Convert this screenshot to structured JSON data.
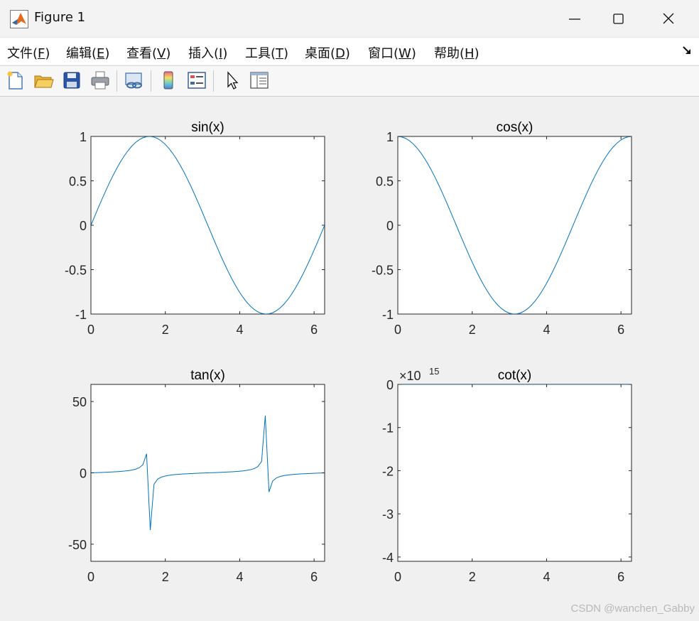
{
  "window": {
    "title": "Figure 1",
    "icon": "matlab-icon",
    "controls": [
      "minimize-icon",
      "maximize-icon",
      "close-icon"
    ]
  },
  "menu": [
    {
      "label": "文件(",
      "key": "F",
      "end": ")"
    },
    {
      "label": "编辑(",
      "key": "E",
      "end": ")"
    },
    {
      "label": "查看(",
      "key": "V",
      "end": ")"
    },
    {
      "label": "插入(",
      "key": "I",
      "end": ")"
    },
    {
      "label": "工具(",
      "key": "T",
      "end": ")"
    },
    {
      "label": "桌面(",
      "key": "D",
      "end": ")"
    },
    {
      "label": "窗口(",
      "key": "W",
      "end": ")"
    },
    {
      "label": "帮助(",
      "key": "H",
      "end": ")"
    }
  ],
  "toolbar": [
    "new-figure-icon",
    "open-file-icon",
    "save-icon",
    "print-icon",
    "link-plot-icon",
    "colorbar-icon",
    "legend-icon",
    "edit-plot-arrow-icon",
    "property-inspector-icon"
  ],
  "colors": {
    "line": "#0072bd",
    "axes": "#262626",
    "plot_bg": "#ffffff",
    "figure_bg": "#f0f0f0"
  },
  "watermark": "CSDN @wanchen_Gabby",
  "chart_data": [
    {
      "type": "line",
      "title": "sin(x)",
      "function": "sin",
      "xlim": [
        0,
        6.2832
      ],
      "ylim": [
        -1,
        1
      ],
      "xticks": [
        "0",
        "2",
        "4",
        "6"
      ],
      "yticks": [
        "1",
        "0.5",
        "0",
        "-0.5",
        "-1"
      ],
      "yticks_values": [
        1,
        0.5,
        0,
        -0.5,
        -1
      ],
      "xticks_values": [
        0,
        2,
        4,
        6
      ],
      "exponent_label": ""
    },
    {
      "type": "line",
      "title": "cos(x)",
      "function": "cos",
      "xlim": [
        0,
        6.2832
      ],
      "ylim": [
        -1,
        1
      ],
      "xticks": [
        "0",
        "2",
        "4",
        "6"
      ],
      "yticks": [
        "1",
        "0.5",
        "0",
        "-0.5",
        "-1"
      ],
      "yticks_values": [
        1,
        0.5,
        0,
        -0.5,
        -1
      ],
      "xticks_values": [
        0,
        2,
        4,
        6
      ],
      "exponent_label": ""
    },
    {
      "type": "line",
      "title": "tan(x)",
      "function": "tan",
      "xlim": [
        0,
        6.2832
      ],
      "ylim": [
        -62,
        62
      ],
      "xticks": [
        "0",
        "2",
        "4",
        "6"
      ],
      "yticks": [
        "50",
        "0",
        "-50"
      ],
      "yticks_values": [
        50,
        0,
        -50
      ],
      "xticks_values": [
        0,
        2,
        4,
        6
      ],
      "exponent_label": ""
    },
    {
      "type": "line",
      "title": "cot(x)",
      "function": "cot",
      "xlim": [
        0,
        6.2832
      ],
      "ylim": [
        -4.1,
        0
      ],
      "xticks": [
        "0",
        "2",
        "4",
        "6"
      ],
      "yticks": [
        "0",
        "-1",
        "-2",
        "-3",
        "-4"
      ],
      "yticks_values": [
        0,
        -1,
        -2,
        -3,
        -4
      ],
      "xticks_values": [
        0,
        2,
        4,
        6
      ],
      "exponent_label": "×10",
      "exponent": "15"
    }
  ]
}
